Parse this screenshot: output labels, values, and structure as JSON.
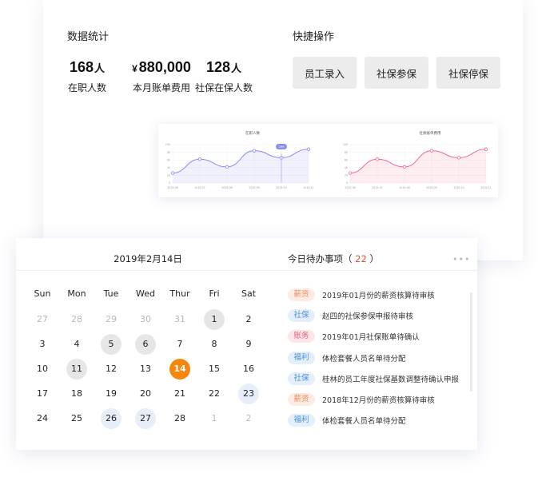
{
  "stats": {
    "title": "数据统计",
    "items": [
      {
        "value": "168",
        "unit": "人",
        "label": "在职人数"
      },
      {
        "currency": "¥",
        "value": "880,000",
        "label": "本月账单费用"
      },
      {
        "value": "128",
        "unit": "人",
        "label": "社保在保人数"
      }
    ]
  },
  "quick_actions": {
    "title": "快捷操作",
    "buttons": [
      "员工录入",
      "社保参保",
      "社保停保"
    ]
  },
  "chart_data": [
    {
      "type": "area",
      "title": "在职人数",
      "color": "#8c8cf2",
      "x": [
        "2019-06",
        "2019-07",
        "2019-08",
        "2019-09",
        "2019-10",
        "2019-11"
      ],
      "values": [
        26,
        62,
        42,
        84,
        66,
        88
      ],
      "ylim": [
        0,
        100
      ],
      "tooltip": "299"
    },
    {
      "type": "area",
      "title": "社保账单费用",
      "color": "#f36a8e",
      "x": [
        "2019-06",
        "2019-07",
        "2019-08",
        "2019-09",
        "2019-10",
        "2019-11"
      ],
      "values": [
        26,
        62,
        42,
        84,
        66,
        88
      ],
      "ylim": [
        0,
        100
      ]
    }
  ],
  "calendar": {
    "date_title": "2019年2月14日",
    "weekdays": [
      "Sun",
      "Mon",
      "Tue",
      "Wed",
      "Thur",
      "Fri",
      "Sat"
    ],
    "weeks": [
      [
        {
          "d": "27",
          "s": "muted"
        },
        {
          "d": "28",
          "s": "muted"
        },
        {
          "d": "29",
          "s": "muted"
        },
        {
          "d": "30",
          "s": "muted"
        },
        {
          "d": "31",
          "s": "muted"
        },
        {
          "d": "1",
          "s": "gray"
        },
        {
          "d": "2",
          "s": ""
        }
      ],
      [
        {
          "d": "3",
          "s": ""
        },
        {
          "d": "4",
          "s": ""
        },
        {
          "d": "5",
          "s": "gray"
        },
        {
          "d": "6",
          "s": "gray"
        },
        {
          "d": "7",
          "s": ""
        },
        {
          "d": "8",
          "s": ""
        },
        {
          "d": "9",
          "s": ""
        }
      ],
      [
        {
          "d": "10",
          "s": ""
        },
        {
          "d": "11",
          "s": "gray"
        },
        {
          "d": "12",
          "s": ""
        },
        {
          "d": "13",
          "s": ""
        },
        {
          "d": "14",
          "s": "today"
        },
        {
          "d": "15",
          "s": ""
        },
        {
          "d": "16",
          "s": ""
        }
      ],
      [
        {
          "d": "17",
          "s": ""
        },
        {
          "d": "18",
          "s": ""
        },
        {
          "d": "19",
          "s": ""
        },
        {
          "d": "20",
          "s": ""
        },
        {
          "d": "21",
          "s": ""
        },
        {
          "d": "22",
          "s": ""
        },
        {
          "d": "23",
          "s": "blue"
        }
      ],
      [
        {
          "d": "24",
          "s": ""
        },
        {
          "d": "25",
          "s": ""
        },
        {
          "d": "26",
          "s": "blue"
        },
        {
          "d": "27",
          "s": "blue"
        },
        {
          "d": "28",
          "s": ""
        },
        {
          "d": "1",
          "s": "muted"
        },
        {
          "d": "2",
          "s": "muted"
        }
      ]
    ]
  },
  "todo": {
    "title": "今日待办事项",
    "count": "22",
    "more_icon": "more-dots-icon",
    "items": [
      {
        "tag": "薪资",
        "tag_color": "#f08a5d",
        "tag_bg": "#fdece3",
        "text": "2019年01月份的薪资核算待审核"
      },
      {
        "tag": "社保",
        "tag_color": "#4a90d9",
        "tag_bg": "#e4effa",
        "text": "赵四的社保参保申报待审核"
      },
      {
        "tag": "账务",
        "tag_color": "#e8607a",
        "tag_bg": "#fde6ea",
        "text": "2019年01月社保账单待确认"
      },
      {
        "tag": "福利",
        "tag_color": "#4a90d9",
        "tag_bg": "#e4effa",
        "text": "体检套餐人员名单待分配"
      },
      {
        "tag": "社保",
        "tag_color": "#4a90d9",
        "tag_bg": "#e4effa",
        "text": "桂林的员工年度社保基数调整待确认申报"
      },
      {
        "tag": "薪资",
        "tag_color": "#f08a5d",
        "tag_bg": "#fdece3",
        "text": "2018年12月份的薪资核算待审核"
      },
      {
        "tag": "福利",
        "tag_color": "#4a90d9",
        "tag_bg": "#e4effa",
        "text": "体检套餐人员名单待分配"
      }
    ]
  }
}
